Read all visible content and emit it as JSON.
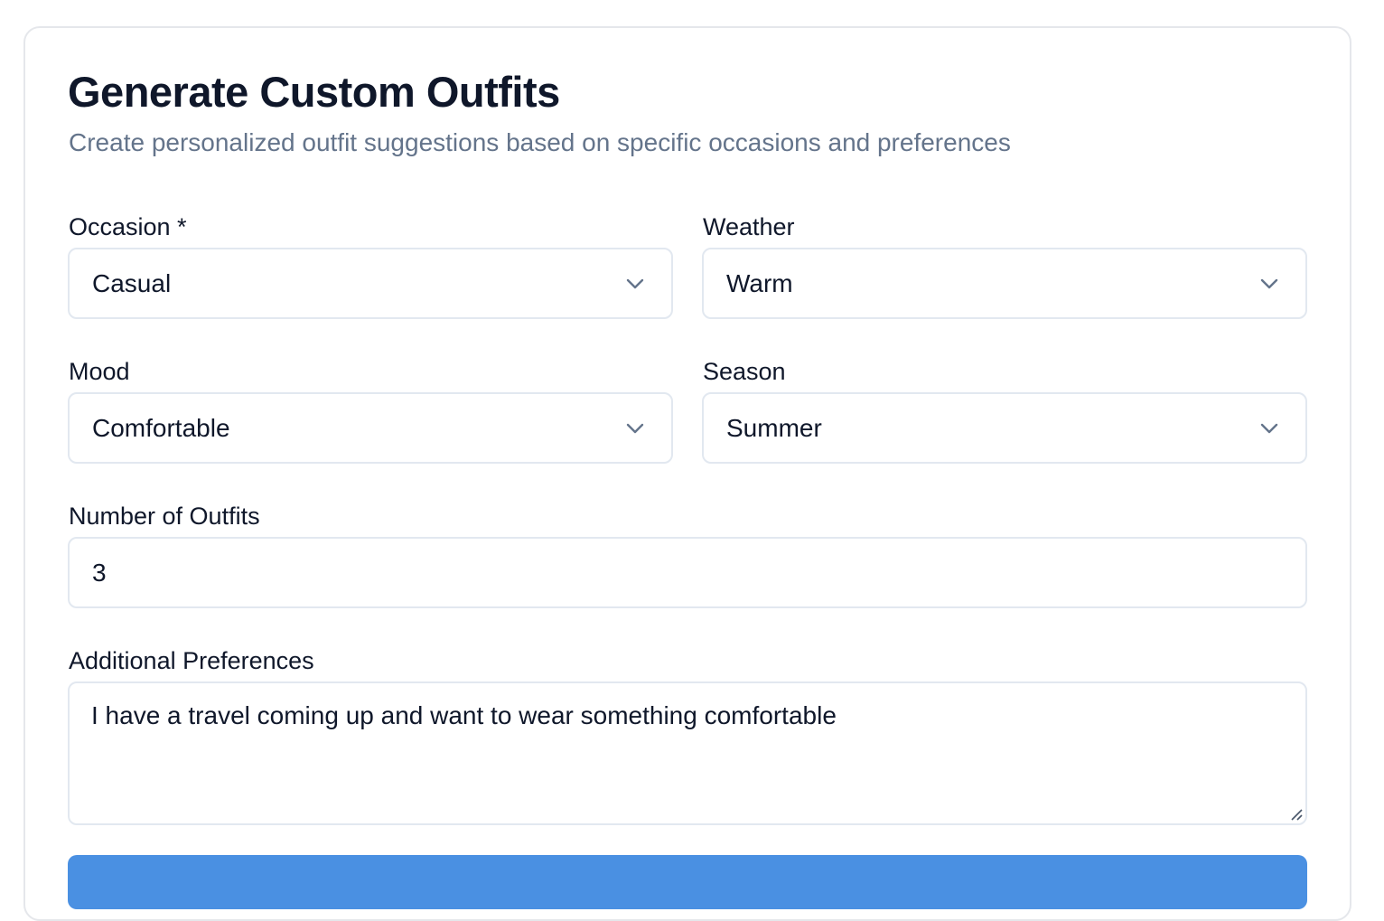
{
  "header": {
    "title": "Generate Custom Outfits",
    "subtitle": "Create personalized outfit suggestions based on specific occasions and preferences"
  },
  "form": {
    "occasion": {
      "label": "Occasion *",
      "value": "Casual"
    },
    "weather": {
      "label": "Weather",
      "value": "Warm"
    },
    "mood": {
      "label": "Mood",
      "value": "Comfortable"
    },
    "season": {
      "label": "Season",
      "value": "Summer"
    },
    "number_of_outfits": {
      "label": "Number of Outfits",
      "value": "3"
    },
    "additional_preferences": {
      "label": "Additional Preferences",
      "value": "I have a travel coming up and want to wear something comfortable"
    },
    "submit": {
      "color": "#4a90e2"
    }
  },
  "icons": {
    "select_chevron": "chevron-down-icon",
    "textarea_resize": "resize-handle-icon"
  }
}
